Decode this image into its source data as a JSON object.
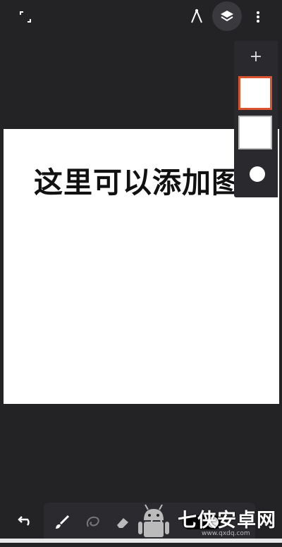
{
  "canvas": {
    "caption": "这里可以添加图层",
    "background": "#ffffff"
  },
  "toolbar": {
    "fullscreen_icon": "fullscreen-icon",
    "ruler_icon": "compass-ruler-icon",
    "layers_icon": "layers-icon",
    "menu_icon": "more-vert-icon"
  },
  "layers_panel": {
    "add_label": "+",
    "layers": [
      {
        "state": "selected",
        "highlight": "#d9532f"
      },
      {
        "state": "normal"
      }
    ]
  },
  "bottom_tools": [
    "undo-icon",
    "brush-icon",
    "lasso-icon",
    "eraser-icon",
    "circle-tool-icon",
    "toggle-icon"
  ],
  "watermark": {
    "text": "七侠安卓网",
    "url": "www.qxdq.com"
  }
}
